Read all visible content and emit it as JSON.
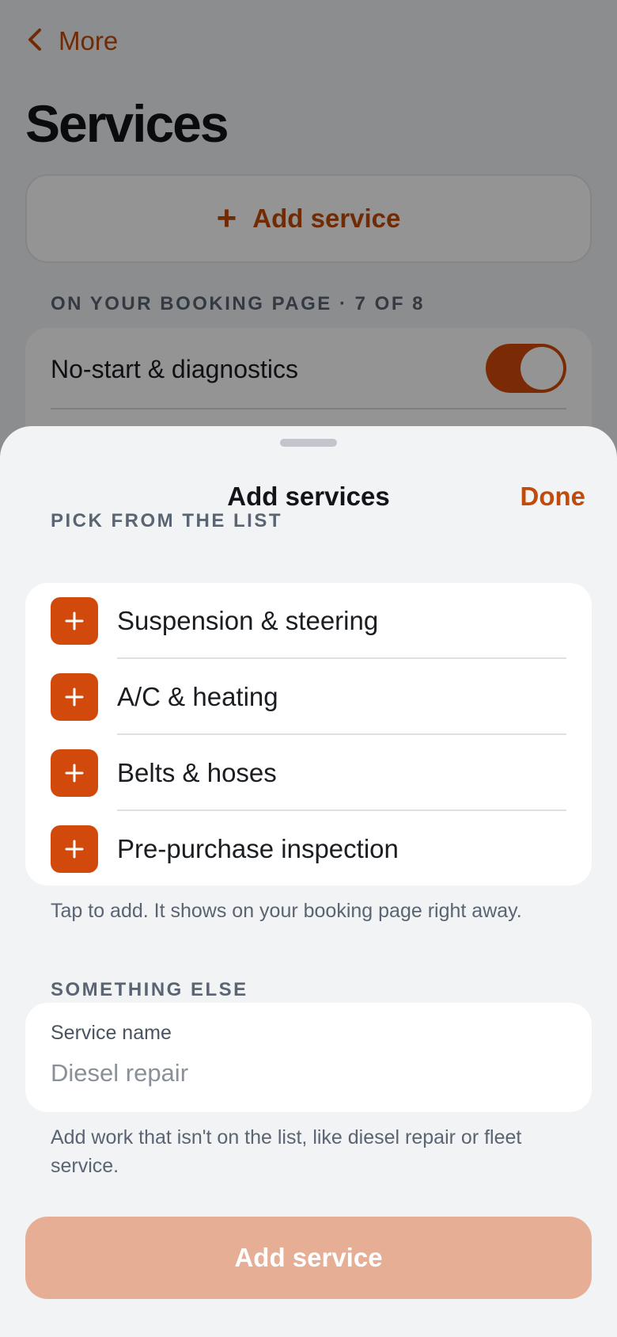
{
  "background": {
    "back_label": "More",
    "page_title": "Services",
    "add_service_label": "Add service",
    "section_label": "ON YOUR BOOKING PAGE · 7 OF 8",
    "first_service": {
      "label": "No-start & diagnostics",
      "enabled": true
    }
  },
  "sheet": {
    "title": "Add services",
    "done_label": "Done",
    "pick_section_label": "PICK FROM THE LIST",
    "pick_items": [
      {
        "label": "Suspension & steering"
      },
      {
        "label": "A/C & heating"
      },
      {
        "label": "Belts & hoses"
      },
      {
        "label": "Pre-purchase inspection"
      }
    ],
    "pick_help": "Tap to add. It shows on your booking page right away.",
    "custom_section_label": "SOMETHING ELSE",
    "field_label": "Service name",
    "field_placeholder": "Diesel repair",
    "field_value": "",
    "custom_help": "Add work that isn't on the list, like diesel repair or fleet service.",
    "primary_button_label": "Add service",
    "primary_button_enabled": false
  },
  "colors": {
    "accent": "#c24a0a",
    "accent_fill": "#d24a0b",
    "disabled_button": "#e6ae94"
  },
  "icons": {
    "back": "chevron-left-icon",
    "add": "plus-icon"
  }
}
